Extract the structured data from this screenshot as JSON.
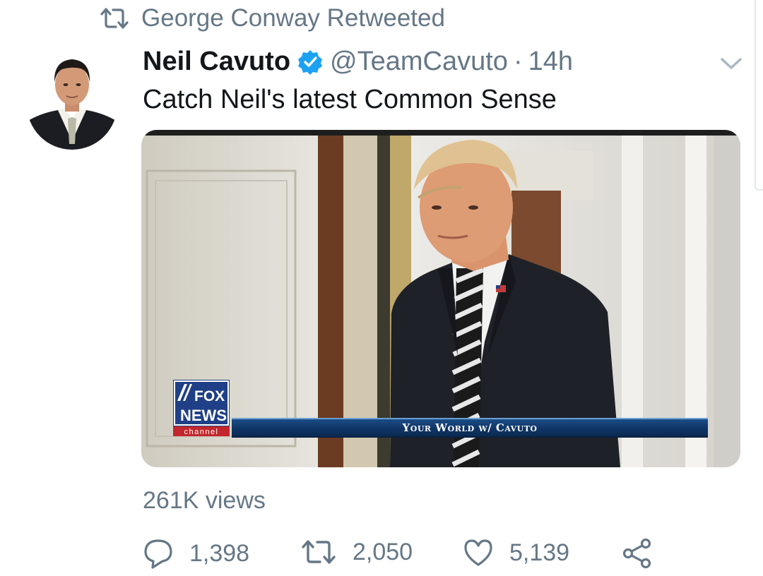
{
  "retweet": {
    "icon": "retweet-icon",
    "text": "George Conway Retweeted"
  },
  "tweet": {
    "avatar_icon": "avatar",
    "display_name": "Neil Cavuto",
    "verified_icon": "verified-badge-icon",
    "handle": "@TeamCavuto",
    "separator": "·",
    "time": "14h",
    "more_icon": "chevron-down-icon",
    "text": "Catch Neil's latest Common Sense"
  },
  "media": {
    "network_logo": [
      "FOX",
      "NEWS",
      "channel"
    ],
    "lower_third": "Your World w/ Cavuto"
  },
  "stats": {
    "views": "261K views"
  },
  "actions": {
    "reply_icon": "reply-icon",
    "reply_count": "1,398",
    "retweet_icon": "retweet-icon",
    "retweet_count": "2,050",
    "like_icon": "heart-icon",
    "like_count": "5,139",
    "share_icon": "share-icon"
  },
  "colors": {
    "text": "#14171a",
    "muted": "#657786",
    "verified": "#1da1f2",
    "lower_third": "#0f3566"
  }
}
